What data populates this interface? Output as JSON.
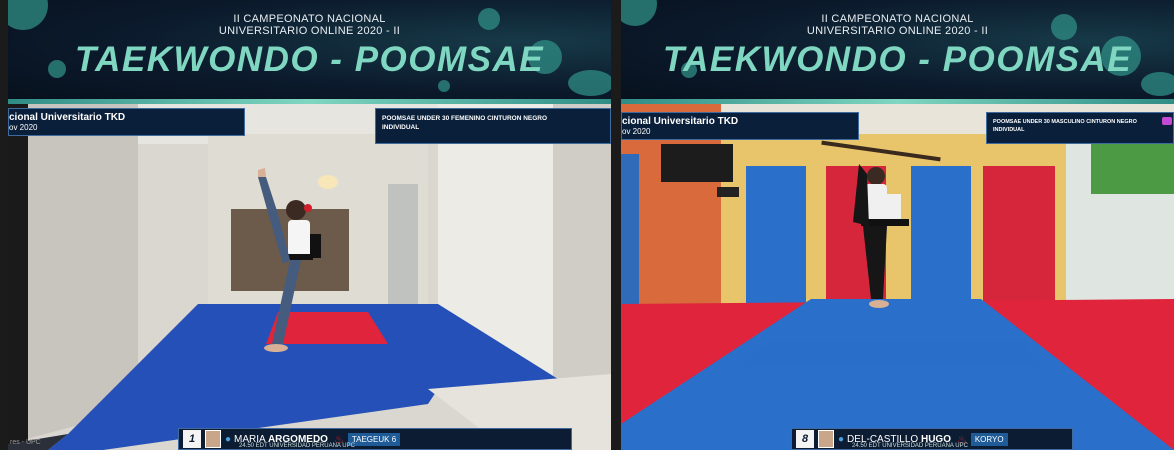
{
  "left_panel": {
    "banner": {
      "subtitle_line1": "II CAMPEONATO NACIONAL",
      "subtitle_line2": "UNIVERSITARIO ONLINE 2020 - II",
      "title": "TAEKWONDO - POOMSAE"
    },
    "event_box": {
      "line1": "cional Universitario TKD",
      "line2": "ov 2020"
    },
    "category_box": {
      "line1": "POOMSAE UNDER 30 FEMENINO CINTURON NEGRO",
      "line2": "INDIVIDUAL"
    },
    "athlete": {
      "number": "1",
      "first_name": "MARIA",
      "last_name": "ARGOMEDO",
      "affiliation": "24.50 EDT UNIVERSIDAD PERUANA UPC",
      "tag": "TAEGEUK 6"
    },
    "edge_text": "res - UPC"
  },
  "right_panel": {
    "banner": {
      "subtitle_line1": "II CAMPEONATO NACIONAL",
      "subtitle_line2": "UNIVERSITARIO ONLINE 2020 - II",
      "title": "TAEKWONDO - POOMSAE"
    },
    "event_box": {
      "line1": "cional Universitario TKD",
      "line2": "ov 2020"
    },
    "category_box": {
      "line1": "POOMSAE UNDER 30 MASCULINO CINTURON NEGRO",
      "line2": "INDIVIDUAL"
    },
    "athlete": {
      "number": "8",
      "first_name": "DEL-CASTILLO",
      "last_name": "HUGO",
      "affiliation": "24.50 EDT UNIVERSIDAD PERUANA UPC",
      "tag": "KORYO"
    }
  },
  "colors": {
    "title_teal": "#7fd6c1",
    "banner_navy": "#0b1a2c",
    "overlay_navy": "#0a1f3a",
    "mat_blue": "#2450b8",
    "mat_red": "#e0243b"
  },
  "icons": [
    "camera-icon",
    "university-logo-icon"
  ]
}
